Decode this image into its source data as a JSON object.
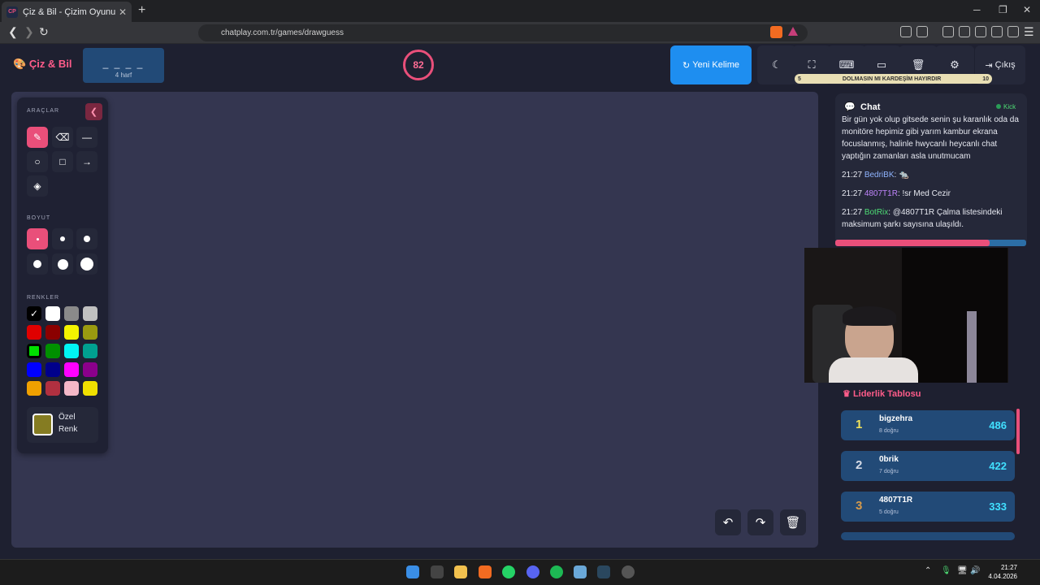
{
  "browser": {
    "tab_title": "Çiz & Bil - Çizim Oyunu",
    "tab_favicon": "CP",
    "url": "chatplay.com.tr/games/drawguess"
  },
  "header": {
    "logo": "Çiz & Bil",
    "word_mask": "_ _ _ _",
    "word_length": "4 harf",
    "timer": "82",
    "new_word": "Yeni Kelime",
    "exit": "Çıkış",
    "progress": {
      "left": "5",
      "text": "DOLMASIN MI KARDEŞİM HAYIRDIR",
      "right": "10"
    }
  },
  "tools": {
    "section_tools": "ARAÇLAR",
    "section_size": "BOYUT",
    "section_colors": "RENKLER",
    "custom_color": "Özel Renk",
    "custom_color_value": "#857c22",
    "colors": [
      "#000000",
      "#ffffff",
      "#8a8a8a",
      "#c0c0c0",
      "#e00000",
      "#8b0000",
      "#f3f300",
      "#9a9a10",
      "#00e000",
      "#009000",
      "#00f5f5",
      "#00a090",
      "#0000ff",
      "#00008b",
      "#ff00ff",
      "#8b008b",
      "#f0a000",
      "#b03040",
      "#f4b8c8",
      "#f0e000"
    ]
  },
  "chat": {
    "title": "Chat",
    "platform": "Kick",
    "messages": [
      {
        "time": "",
        "user": "",
        "text": "Bir gün yok olup gitsede senin şu karanlık oda da monitöre hepimiz gibi yarım kambur ekrana focuslanmış, halinle hwycanlı heycanlı chat yaptığın zamanları asla unutmucam",
        "color": "#e6e8f0"
      },
      {
        "time": "21:27",
        "user": "BedriBK",
        "text": ": 🐀",
        "color": "#8fb4ff"
      },
      {
        "time": "21:27",
        "user": "4807T1R",
        "text": ": !sr Med Cezir",
        "color": "#c084fc"
      },
      {
        "time": "21:27",
        "user": "BotRix",
        "text": ": @4807T1R Çalma listesindeki maksimum şarkı sayısına ulaşıldı.",
        "color": "#4ddc74"
      }
    ]
  },
  "leaderboard": {
    "title": "Liderlik Tablosu",
    "rows": [
      {
        "rank": "1",
        "name": "bigzehra",
        "correct": "8 doğru",
        "score": "486",
        "rank_color": "#f3e35a"
      },
      {
        "rank": "2",
        "name": "0brik",
        "correct": "7 doğru",
        "score": "422",
        "rank_color": "#d6dbe6"
      },
      {
        "rank": "3",
        "name": "4807T1R",
        "correct": "5 doğru",
        "score": "333",
        "rank_color": "#d69a4a"
      }
    ]
  },
  "taskbar": {
    "time": "21:27",
    "date": "4.04.2026"
  }
}
